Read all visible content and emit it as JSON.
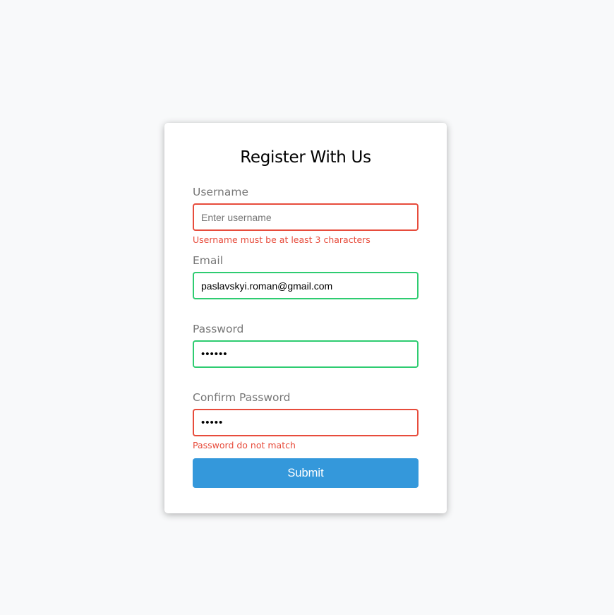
{
  "form": {
    "title": "Register With Us",
    "username": {
      "label": "Username",
      "value": "",
      "placeholder": "Enter username",
      "error": "Username must be at least 3 characters",
      "state": "error"
    },
    "email": {
      "label": "Email",
      "value": "paslavskyi.roman@gmail.com",
      "error": "",
      "state": "success"
    },
    "password": {
      "label": "Password",
      "value": "••••••",
      "error": "",
      "state": "success"
    },
    "confirm_password": {
      "label": "Confirm Password",
      "value": "•••••",
      "error": "Password do not match",
      "state": "error"
    },
    "submit_label": "Submit"
  },
  "colors": {
    "error": "#e74c3c",
    "success": "#2ecc71",
    "primary": "#3498db",
    "background": "#f8f9fa"
  }
}
